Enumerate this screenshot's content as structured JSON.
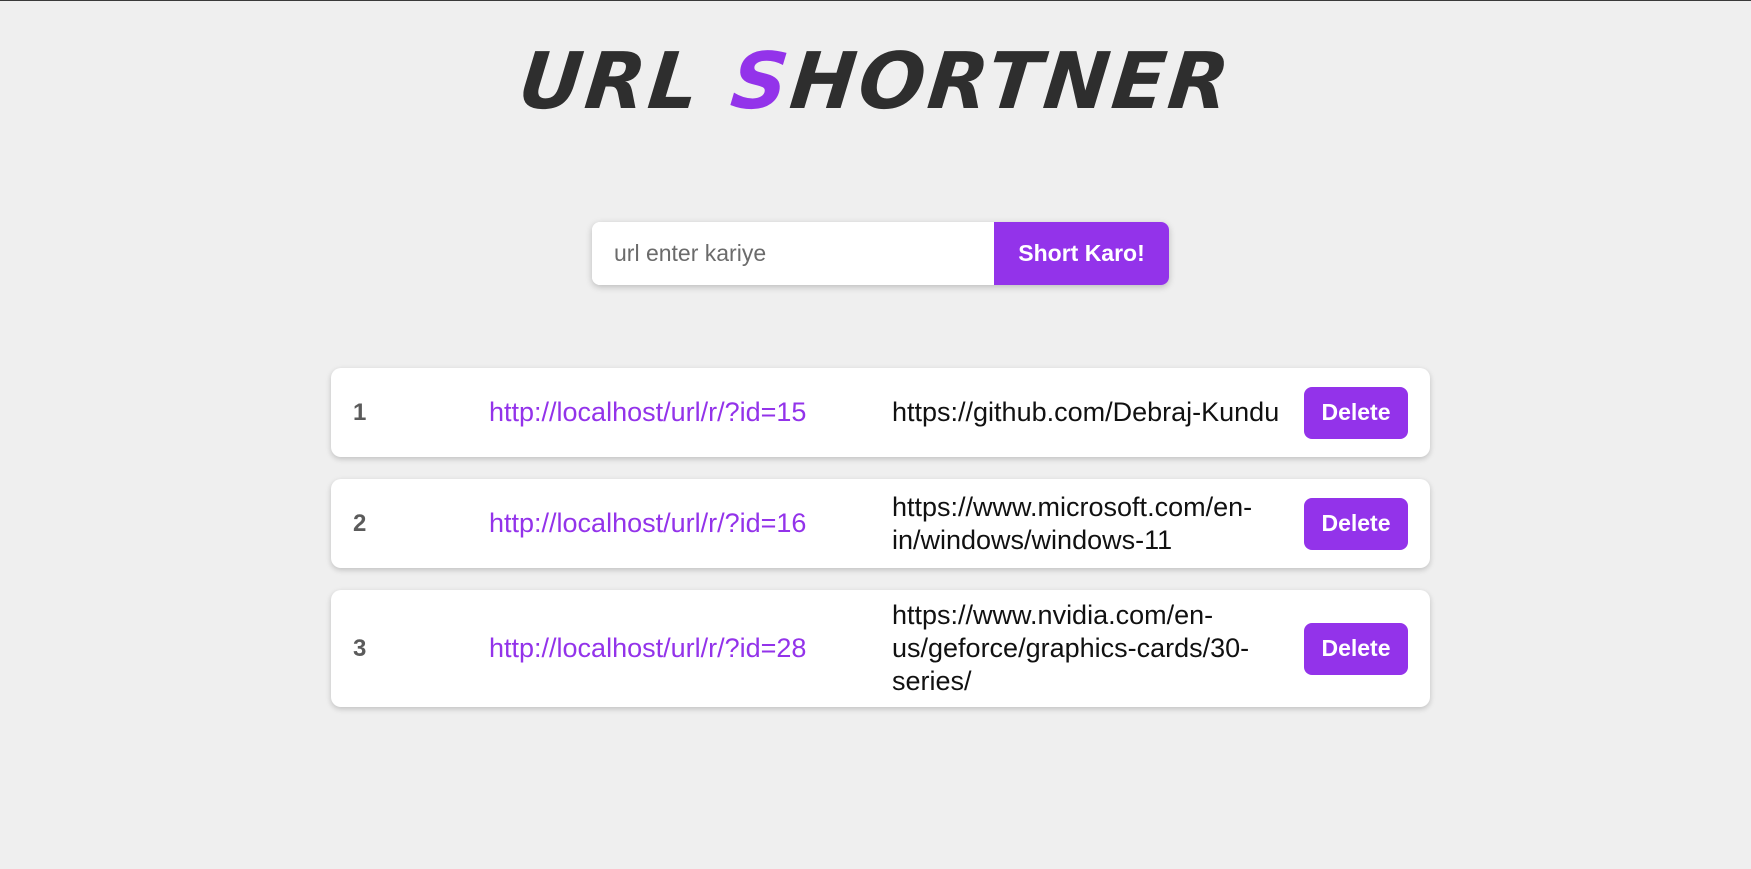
{
  "header": {
    "title_part1": "URL ",
    "title_accent": "S",
    "title_part2": "HORTNER"
  },
  "form": {
    "input_placeholder": "url enter kariye",
    "input_value": "",
    "submit_label": "Short Karo!"
  },
  "links": [
    {
      "index": "1",
      "short_url": "http://localhost/url/r/?id=15",
      "original_url": "https://github.com/Debraj-Kundu",
      "delete_label": "Delete"
    },
    {
      "index": "2",
      "short_url": "http://localhost/url/r/?id=16",
      "original_url": "https://www.microsoft.com/en-in/windows/windows-11",
      "delete_label": "Delete"
    },
    {
      "index": "3",
      "short_url": "http://localhost/url/r/?id=28",
      "original_url": "https://www.nvidia.com/en-us/geforce/graphics-cards/30-series/",
      "delete_label": "Delete"
    }
  ],
  "colors": {
    "accent": "#9333ea",
    "background": "#efefef",
    "title": "#2e2e2e"
  }
}
